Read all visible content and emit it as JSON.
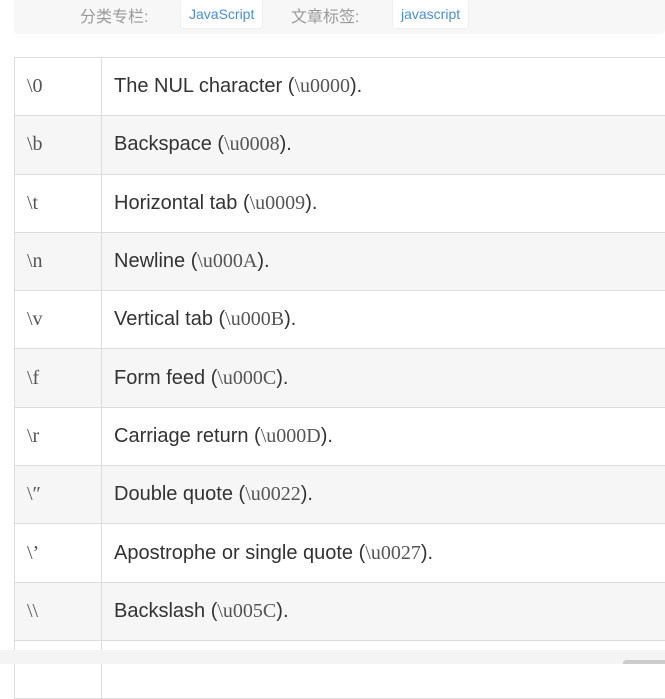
{
  "meta": {
    "category_label": "分类专栏:",
    "category": "JavaScript",
    "tags_label": "文章标签:",
    "tag": "javascript"
  },
  "rows": [
    {
      "code": "\\0",
      "desc": "The NUL character (",
      "uni": "\\u0000",
      "end": ")."
    },
    {
      "code": "\\b",
      "desc": "Backspace (",
      "uni": "\\u0008",
      "end": ")."
    },
    {
      "code": "\\t",
      "desc": "Horizontal tab (",
      "uni": "\\u0009",
      "end": ")."
    },
    {
      "code": "\\n",
      "desc": "Newline (",
      "uni": "\\u000A",
      "end": ")."
    },
    {
      "code": "\\v",
      "desc": "Vertical tab (",
      "uni": "\\u000B",
      "end": ")."
    },
    {
      "code": "\\f",
      "desc": "Form feed (",
      "uni": "\\u000C",
      "end": ")."
    },
    {
      "code": "\\r",
      "desc": "Carriage return (",
      "uni": "\\u000D",
      "end": ")."
    },
    {
      "code": "\\″",
      "desc": "Double quote (",
      "uni": "\\u0022",
      "end": ")."
    },
    {
      "code": "\\’",
      "desc": "Apostrophe or single quote (",
      "uni": "\\u0027",
      "end": ")."
    },
    {
      "code": "\\\\",
      "desc": "Backslash (",
      "uni": "\\u005C",
      "end": ")."
    }
  ]
}
